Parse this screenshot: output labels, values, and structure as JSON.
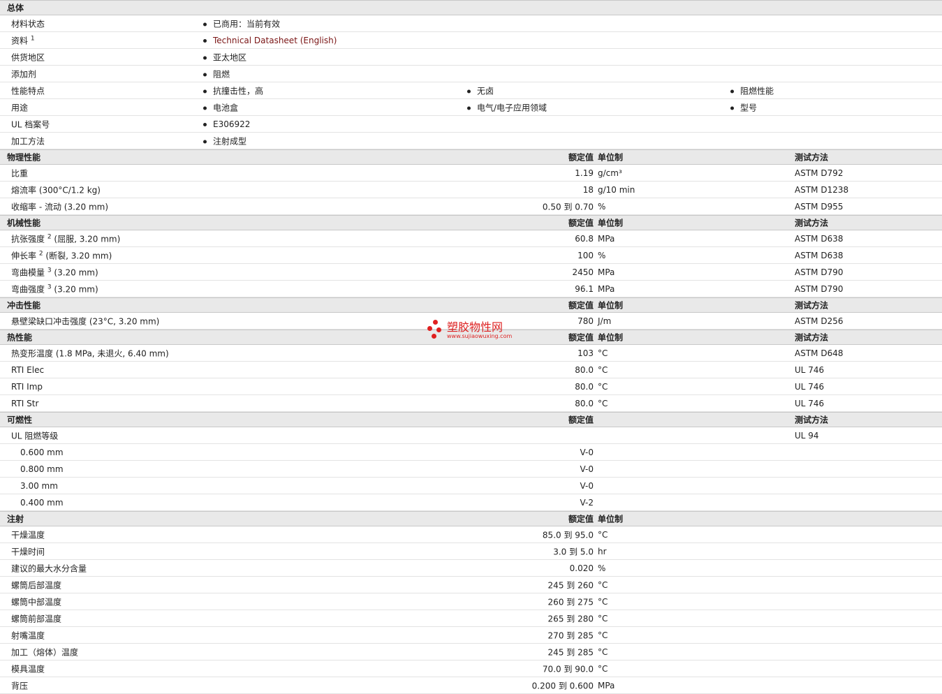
{
  "watermark": {
    "name": "塑胶物性网",
    "url": "www.sujiaowuxing.com"
  },
  "general": {
    "title": "总体",
    "rows": [
      {
        "label": "材料状态",
        "items": [
          "已商用：当前有效"
        ]
      },
      {
        "label": "资料",
        "sup": "1",
        "items": [
          "Technical Datasheet (English)"
        ],
        "link": true
      },
      {
        "label": "供货地区",
        "items": [
          "亚太地区"
        ]
      },
      {
        "label": "添加剂",
        "items": [
          "阻燃"
        ]
      },
      {
        "label": "性能特点",
        "items": [
          "抗撞击性，高",
          "无卤",
          "阻燃性能"
        ]
      },
      {
        "label": "用途",
        "items": [
          "电池盒",
          "电气/电子应用领域",
          "型号"
        ]
      },
      {
        "label": "UL 档案号",
        "items": [
          "E306922"
        ]
      },
      {
        "label": "加工方法",
        "items": [
          "注射成型"
        ]
      }
    ]
  },
  "sections": [
    {
      "title": "物理性能",
      "rated": "额定值",
      "unit": "单位制",
      "method": "测试方法",
      "rows": [
        {
          "label": "比重",
          "value": "1.19",
          "unit": "g/cm³",
          "method": "ASTM D792"
        },
        {
          "label": "熔流率  (300°C/1.2 kg)",
          "value": "18",
          "unit": "g/10 min",
          "method": "ASTM D1238"
        },
        {
          "label": "收缩率  - 流动  (3.20 mm)",
          "value": "0.50 到  0.70",
          "unit": "%",
          "method": "ASTM D955"
        }
      ]
    },
    {
      "title": "机械性能",
      "rated": "额定值",
      "unit": "单位制",
      "method": "测试方法",
      "rows": [
        {
          "label": "抗张强度",
          "sup": "2",
          "suffix": " (屈服, 3.20 mm)",
          "value": "60.8",
          "unit": "MPa",
          "method": "ASTM D638"
        },
        {
          "label": "伸长率",
          "sup": "2",
          "suffix": " (断裂, 3.20 mm)",
          "value": "100",
          "unit": "%",
          "method": "ASTM D638"
        },
        {
          "label": "弯曲模量",
          "sup": "3",
          "suffix": " (3.20 mm)",
          "value": "2450",
          "unit": "MPa",
          "method": "ASTM D790"
        },
        {
          "label": "弯曲强度",
          "sup": "3",
          "suffix": " (3.20 mm)",
          "value": "96.1",
          "unit": "MPa",
          "method": "ASTM D790"
        }
      ]
    },
    {
      "title": "冲击性能",
      "rated": "额定值",
      "unit": "单位制",
      "method": "测试方法",
      "rows": [
        {
          "label": "悬壁梁缺口冲击强度  (23°C, 3.20 mm)",
          "value": "780",
          "unit": "J/m",
          "method": "ASTM D256"
        }
      ]
    },
    {
      "title": "热性能",
      "rated": "额定值",
      "unit": "单位制",
      "method": "测试方法",
      "rows": [
        {
          "label": "热变形温度  (1.8 MPa, 未退火, 6.40 mm)",
          "value": "103",
          "unit": "°C",
          "method": "ASTM D648"
        },
        {
          "label": "RTI Elec",
          "value": "80.0",
          "unit": "°C",
          "method": "UL 746"
        },
        {
          "label": "RTI Imp",
          "value": "80.0",
          "unit": "°C",
          "method": "UL 746"
        },
        {
          "label": "RTI Str",
          "value": "80.0",
          "unit": "°C",
          "method": "UL 746"
        }
      ]
    },
    {
      "title": "可燃性",
      "rated": "额定值",
      "unit": "",
      "method": "测试方法",
      "rows": [
        {
          "label": "UL 阻燃等级",
          "value": "",
          "unit": "",
          "method": "UL 94"
        },
        {
          "label": "0.600 mm",
          "indent": true,
          "value": "V-0",
          "unit": "",
          "method": ""
        },
        {
          "label": "0.800 mm",
          "indent": true,
          "value": "V-0",
          "unit": "",
          "method": ""
        },
        {
          "label": "3.00 mm",
          "indent": true,
          "value": "V-0",
          "unit": "",
          "method": ""
        },
        {
          "label": "0.400 mm",
          "indent": true,
          "value": "V-2",
          "unit": "",
          "method": ""
        }
      ]
    },
    {
      "title": "注射",
      "rated": "额定值",
      "unit": "单位制",
      "method": "",
      "rows": [
        {
          "label": "干燥温度",
          "value": "85.0 到  95.0",
          "unit": "°C",
          "method": ""
        },
        {
          "label": "干燥时间",
          "value": "3.0 到  5.0",
          "unit": "hr",
          "method": ""
        },
        {
          "label": "建议的最大水分含量",
          "value": "0.020",
          "unit": "%",
          "method": ""
        },
        {
          "label": "螺筒后部温度",
          "value": "245 到  260",
          "unit": "°C",
          "method": ""
        },
        {
          "label": "螺筒中部温度",
          "value": "260 到  275",
          "unit": "°C",
          "method": ""
        },
        {
          "label": "螺筒前部温度",
          "value": "265 到  280",
          "unit": "°C",
          "method": ""
        },
        {
          "label": "射嘴温度",
          "value": "270 到  285",
          "unit": "°C",
          "method": ""
        },
        {
          "label": "加工（熔体）温度",
          "value": "245 到  285",
          "unit": "°C",
          "method": ""
        },
        {
          "label": "模具温度",
          "value": "70.0 到  90.0",
          "unit": "°C",
          "method": ""
        },
        {
          "label": "背压",
          "value": "0.200 到  0.600",
          "unit": "MPa",
          "method": ""
        }
      ]
    }
  ]
}
